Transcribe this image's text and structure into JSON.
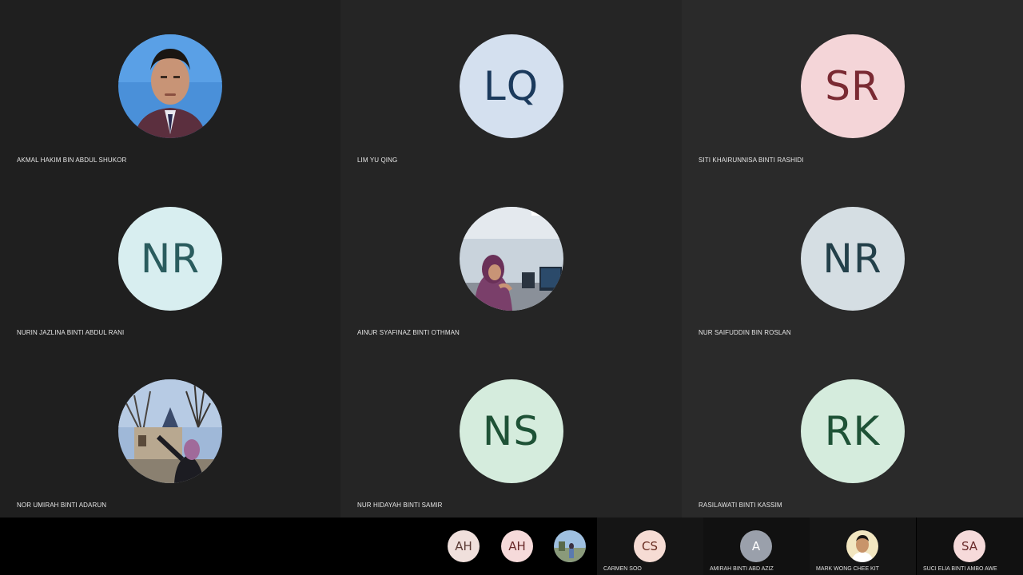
{
  "colors": {
    "background": "#000000",
    "tile_dark": "#1f1f1f",
    "tile_mid": "#252525",
    "name_text": "#e6e6e6"
  },
  "participants": [
    {
      "name": "AKMAL HAKIM BIN ABDUL SHUKOR",
      "initials": "",
      "avatar": "photo-man-portrait"
    },
    {
      "name": "LIM YU QING",
      "initials": "LQ",
      "avatar_bg": "#d4e0ef",
      "avatar_fg": "#1b3a5c"
    },
    {
      "name": "SITI KHAIRUNNISA BINTI RASHIDI",
      "initials": "SR",
      "avatar_bg": "#f4d5d8",
      "avatar_fg": "#7a2a33"
    },
    {
      "name": "NURIN JAZLINA BINTI ABDUL RANI",
      "initials": "NR",
      "avatar_bg": "#d8eef0",
      "avatar_fg": "#2a5c5e"
    },
    {
      "name": "AINUR SYAFINAZ BINTI OTHMAN",
      "initials": "",
      "avatar": "photo-computer-lab"
    },
    {
      "name": "NUR SAIFUDDIN BIN ROSLAN",
      "initials": "NR",
      "avatar_bg": "#d5dee3",
      "avatar_fg": "#23404a"
    },
    {
      "name": "NOR UMIRAH BINTI ADARUN",
      "initials": "",
      "avatar": "photo-castle-outdoor"
    },
    {
      "name": "NUR HIDAYAH BINTI SAMIR",
      "initials": "NS",
      "avatar_bg": "#d5ecdd",
      "avatar_fg": "#1e5236"
    },
    {
      "name": "RASILAWATI BINTI KASSIM",
      "initials": "RK",
      "avatar_bg": "#d5ecdd",
      "avatar_fg": "#1e5236"
    }
  ],
  "strip": {
    "mini_avatars": [
      {
        "initials": "AH",
        "avatar_bg": "#f0e0dc",
        "avatar_fg": "#5a3a34"
      },
      {
        "initials": "AH",
        "avatar_bg": "#f6dada",
        "avatar_fg": "#6a2a2a"
      },
      {
        "initials": "",
        "avatar": "photo-outdoor"
      }
    ],
    "tiles": [
      {
        "name": "CARMEN SOO",
        "initials": "CS",
        "avatar_bg": "#f6dcd4",
        "avatar_fg": "#6a2e22"
      },
      {
        "name": "AMIRAH BINTI ABD AZIZ",
        "initials": "A",
        "avatar_bg": "#9aa0ab",
        "avatar_fg": "#ffffff"
      },
      {
        "name": "MARK WONG CHEE KIT",
        "initials": "",
        "avatar": "photo-man-yellow"
      },
      {
        "name": "SUCI ELIA BINTI AMBO AWE",
        "initials": "SA",
        "avatar_bg": "#f6dada",
        "avatar_fg": "#6a2a2a"
      }
    ]
  }
}
